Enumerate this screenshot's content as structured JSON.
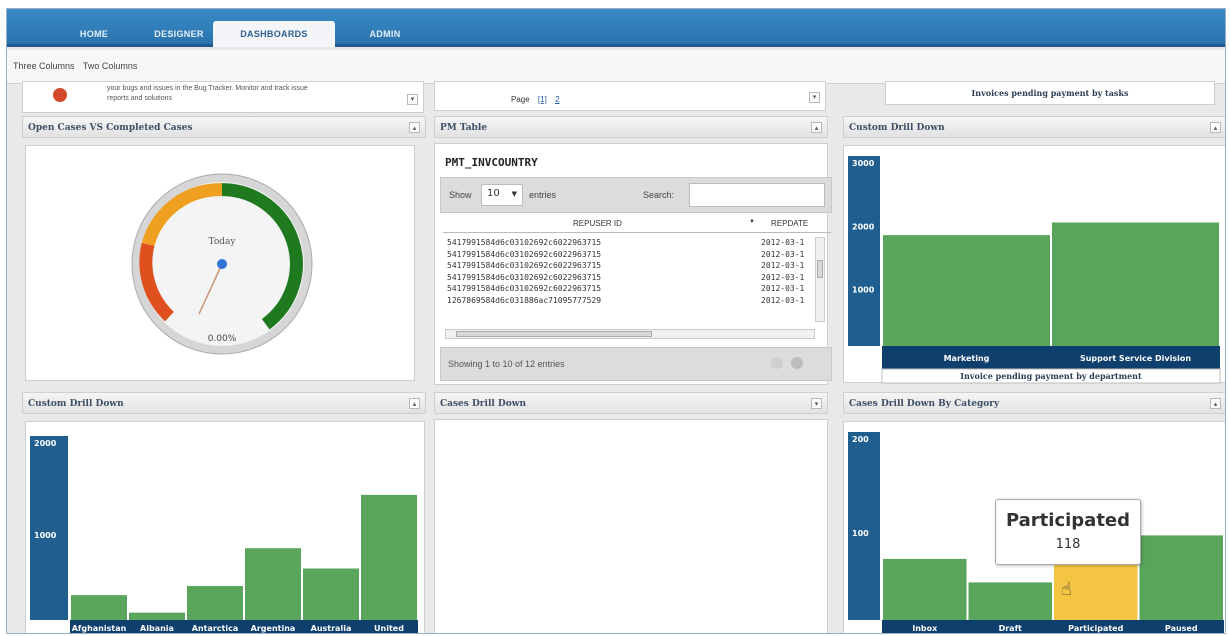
{
  "nav": {
    "tabs": [
      {
        "label": "HOME"
      },
      {
        "label": "DESIGNER"
      },
      {
        "label": "DASHBOARDS",
        "active": true
      },
      {
        "label": "ADMIN"
      }
    ],
    "layouts": [
      "Three Columns",
      "Two Columns"
    ]
  },
  "top_partial": {
    "left_text_1": "your bugs and issues in the Bug Tracker. Monitor and track issue",
    "left_text_2": "reports and solutions",
    "middle_page_label": "Page",
    "middle_page_links": [
      "[1]",
      "2"
    ],
    "right_caption": "Invoices pending payment by tasks"
  },
  "panels": {
    "open_vs_completed": {
      "title": "Open Cases VS Completed Cases",
      "gauge_label": "Today",
      "gauge_value": "0.00%",
      "gauge_percent": 0
    },
    "pm_table": {
      "title": "PM Table",
      "table_name": "PMT_INVCOUNTRY",
      "show_label": "Show",
      "page_size": "10",
      "entries_label": "entries",
      "search_label": "Search:",
      "search_value": "",
      "columns": [
        "REPUSER ID",
        "REPDATE"
      ],
      "rows": [
        {
          "id": "5417991584d6c03102692c6022963715",
          "date": "2012-03-1"
        },
        {
          "id": "5417991584d6c03102692c6022963715",
          "date": "2012-03-1"
        },
        {
          "id": "5417991584d6c03102692c6022963715",
          "date": "2012-03-1"
        },
        {
          "id": "5417991584d6c03102692c6022963715",
          "date": "2012-03-1"
        },
        {
          "id": "5417991584d6c03102692c6022963715",
          "date": "2012-03-1"
        },
        {
          "id": "1267869584d6c031886ac71095777529",
          "date": "2012-03-1"
        }
      ],
      "footer": "Showing 1 to 10 of 12 entries"
    },
    "custom_drill_down_right": {
      "title": "Custom Drill Down",
      "caption": "Invoice pending payment by department"
    },
    "custom_drill_down_left": {
      "title": "Custom Drill Down"
    },
    "cases_drill_down": {
      "title": "Cases Drill Down"
    },
    "cases_by_category": {
      "title": "Cases Drill Down By Category",
      "tooltip_title": "Participated",
      "tooltip_value": "118"
    }
  },
  "chart_data": [
    {
      "type": "bar",
      "panel": "Custom Drill Down (right)",
      "categories": [
        "Marketing",
        "Support Service Division"
      ],
      "values": [
        1750,
        1950
      ],
      "ylim": [
        0,
        3000
      ],
      "yticks": [
        "3000",
        "2000",
        "1000"
      ],
      "bar_color": "#59a55b",
      "axis_color": "#1f5e8e"
    },
    {
      "type": "bar",
      "panel": "Custom Drill Down (left)",
      "categories": [
        "Afghanistan",
        "Albania",
        "Antarctica",
        "Argentina",
        "Australia",
        "United"
      ],
      "values": [
        270,
        80,
        370,
        780,
        560,
        1360
      ],
      "ylim": [
        0,
        2000
      ],
      "yticks": [
        "2000",
        "1000"
      ],
      "bar_color": "#59a55b",
      "axis_color": "#1f5e8e"
    },
    {
      "type": "bar",
      "panel": "Cases Drill Down By Category",
      "categories": [
        "Inbox",
        "Draft",
        "Participated",
        "Paused"
      ],
      "values": [
        65,
        40,
        90,
        90
      ],
      "ylim": [
        0,
        200
      ],
      "yticks": [
        "200",
        "100"
      ],
      "bar_color": "#59a55b",
      "highlight_color": "#f4c542",
      "highlight_index": 2,
      "axis_color": "#1f5e8e"
    }
  ]
}
